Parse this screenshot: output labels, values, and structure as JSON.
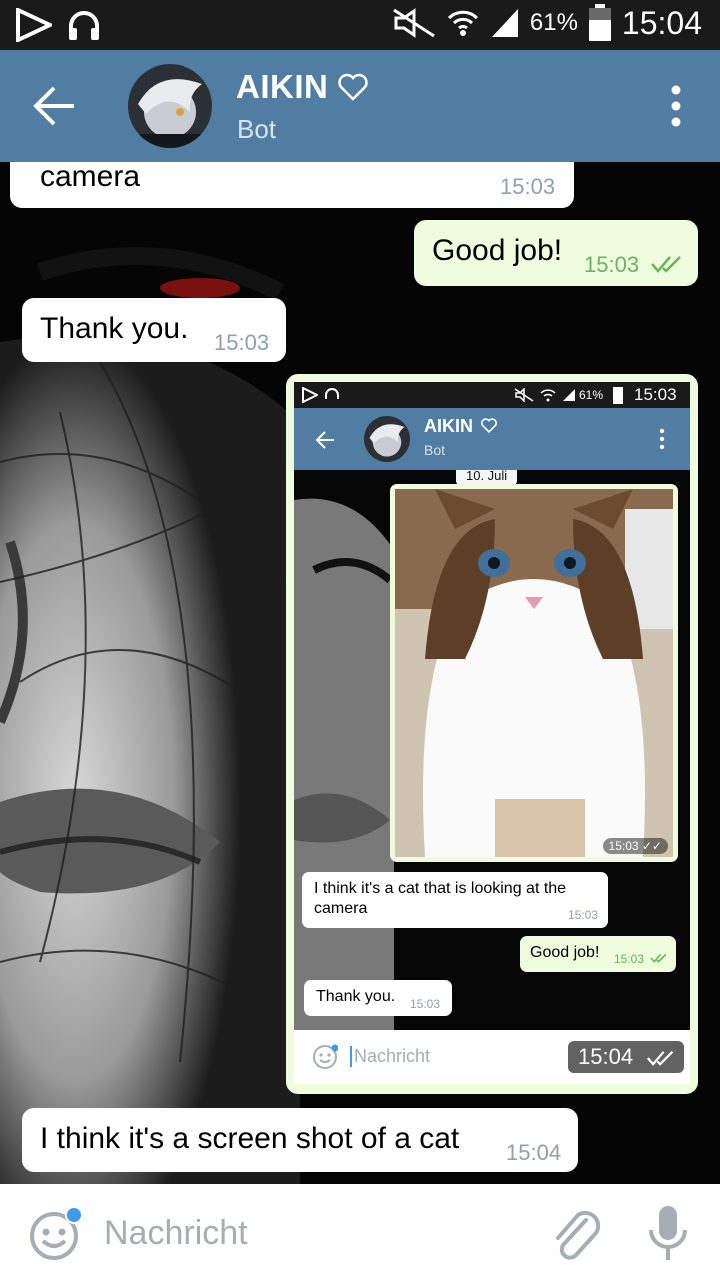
{
  "status_bar": {
    "battery": "61%",
    "time": "15:04"
  },
  "header": {
    "title": "AIKIN",
    "subtitle": "Bot"
  },
  "messages": [
    {
      "text": "camera",
      "time": "15:03"
    },
    {
      "text": "Good job!",
      "time": "15:03"
    },
    {
      "text": "Thank you.",
      "time": "15:03"
    },
    {
      "text": "I think it's a screen shot of a cat",
      "time": "15:04"
    }
  ],
  "shot": {
    "status_battery": "61%",
    "status_time": "15:03",
    "title": "AIKIN",
    "subtitle": "Bot",
    "date_label": "10. Juli",
    "photo_time": "15:03",
    "msg_1_line1": "I think it's a cat that is looking at the",
    "msg_1_line2": "camera",
    "msg_1_time": "15:03",
    "msg_2": "Good job!",
    "msg_2_time": "15:03",
    "msg_3": "Thank you.",
    "msg_3_time": "15:03",
    "input_placeholder": "Nachricht",
    "shot_time": "15:04"
  },
  "input": {
    "placeholder": "Nachricht"
  },
  "colors": {
    "header": "#527da3",
    "outgoing": "#effdde",
    "incoming": "#ffffff",
    "check": "#6bb35c"
  },
  "icons": [
    "play-icon",
    "headphones-icon",
    "mute-icon",
    "wifi-icon",
    "signal-icon",
    "battery-icon",
    "back-arrow-icon",
    "heart-icon",
    "more-vert-icon",
    "emoji-icon",
    "paperclip-icon",
    "mic-icon",
    "double-check-icon"
  ]
}
